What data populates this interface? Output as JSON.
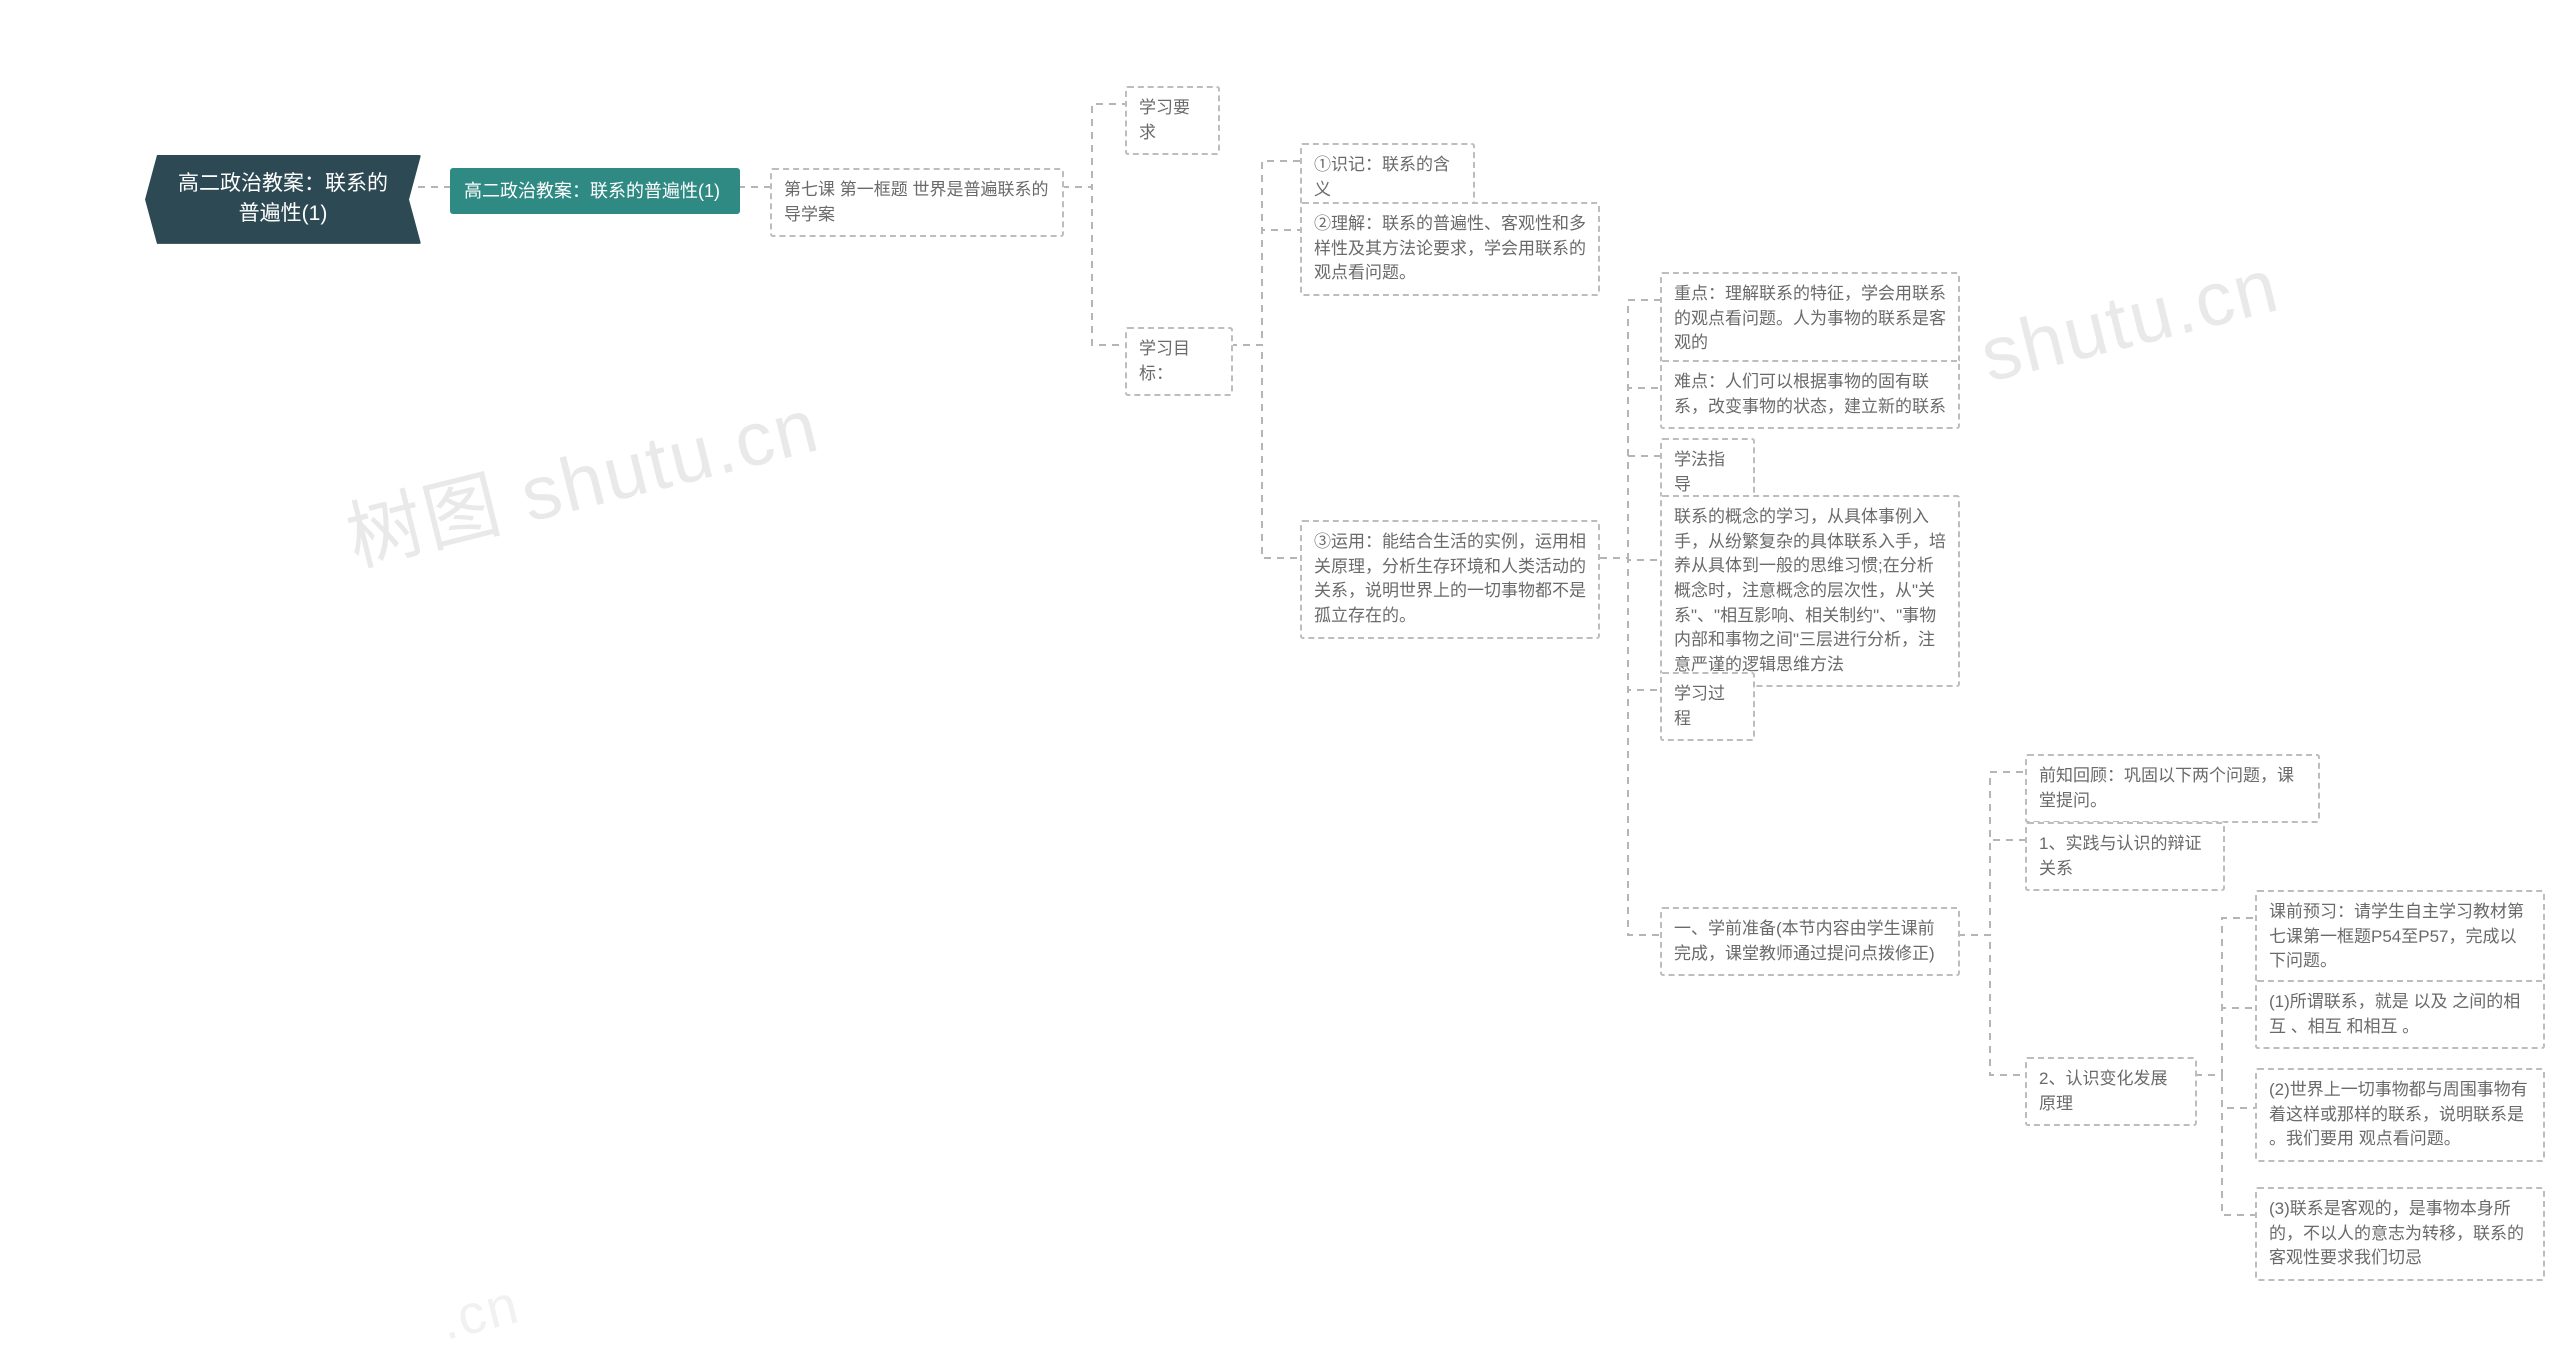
{
  "watermark": "树图 shutu.cn",
  "root": {
    "title": "高二政治教案：联系的普遍性(1)"
  },
  "level1": {
    "title": "高二政治教案：联系的普遍性(1)"
  },
  "level2": {
    "title": "第七课 第一框题 世界是普遍联系的导学案"
  },
  "l3": {
    "req": "学习要求",
    "goal": "学习目标："
  },
  "g1": "①识记：联系的含义",
  "g2": "②理解：联系的普遍性、客观性和多样性及其方法论要求，学会用联系的观点看问题。",
  "g3": "③运用：能结合生活的实例，运用相关原理，分析生存环境和人类活动的关系，说明世界上的一切事物都不是孤立存在的。",
  "g3c": {
    "a": "重点：理解联系的特征，学会用联系的观点看问题。人为事物的联系是客观的",
    "b": "难点：人们可以根据事物的固有联系，改变事物的状态，建立新的联系",
    "c": "学法指导",
    "d": "联系的概念的学习，从具体事例入手，从纷繁复杂的具体联系入手，培养从具体到一般的思维习惯;在分析概念时，注意概念的层次性，从\"关系\"、\"相互影响、相关制约\"、\"事物内部和事物之间\"三层进行分析，注意严谨的逻辑思维方法",
    "e": "学习过程",
    "f": "一、学前准备(本节内容由学生课前完成，课堂教师通过提问点拨修正)"
  },
  "fc": {
    "a": "前知回顾：巩固以下两个问题，课堂提问。",
    "b": "1、实践与认识的辩证关系",
    "c": "2、认识变化发展原理"
  },
  "cc": {
    "a": "课前预习：请学生自主学习教材第七课第一框题P54至P57，完成以下问题。",
    "b": "(1)所谓联系，就是 以及 之间的相互 、相互 和相互 。",
    "c": "(2)世界上一切事物都与周围事物有着这样或那样的联系，说明联系是 。我们要用 观点看问题。",
    "d": "(3)联系是客观的，是事物本身所 的，不以人的意志为转移，联系的客观性要求我们切忌"
  }
}
